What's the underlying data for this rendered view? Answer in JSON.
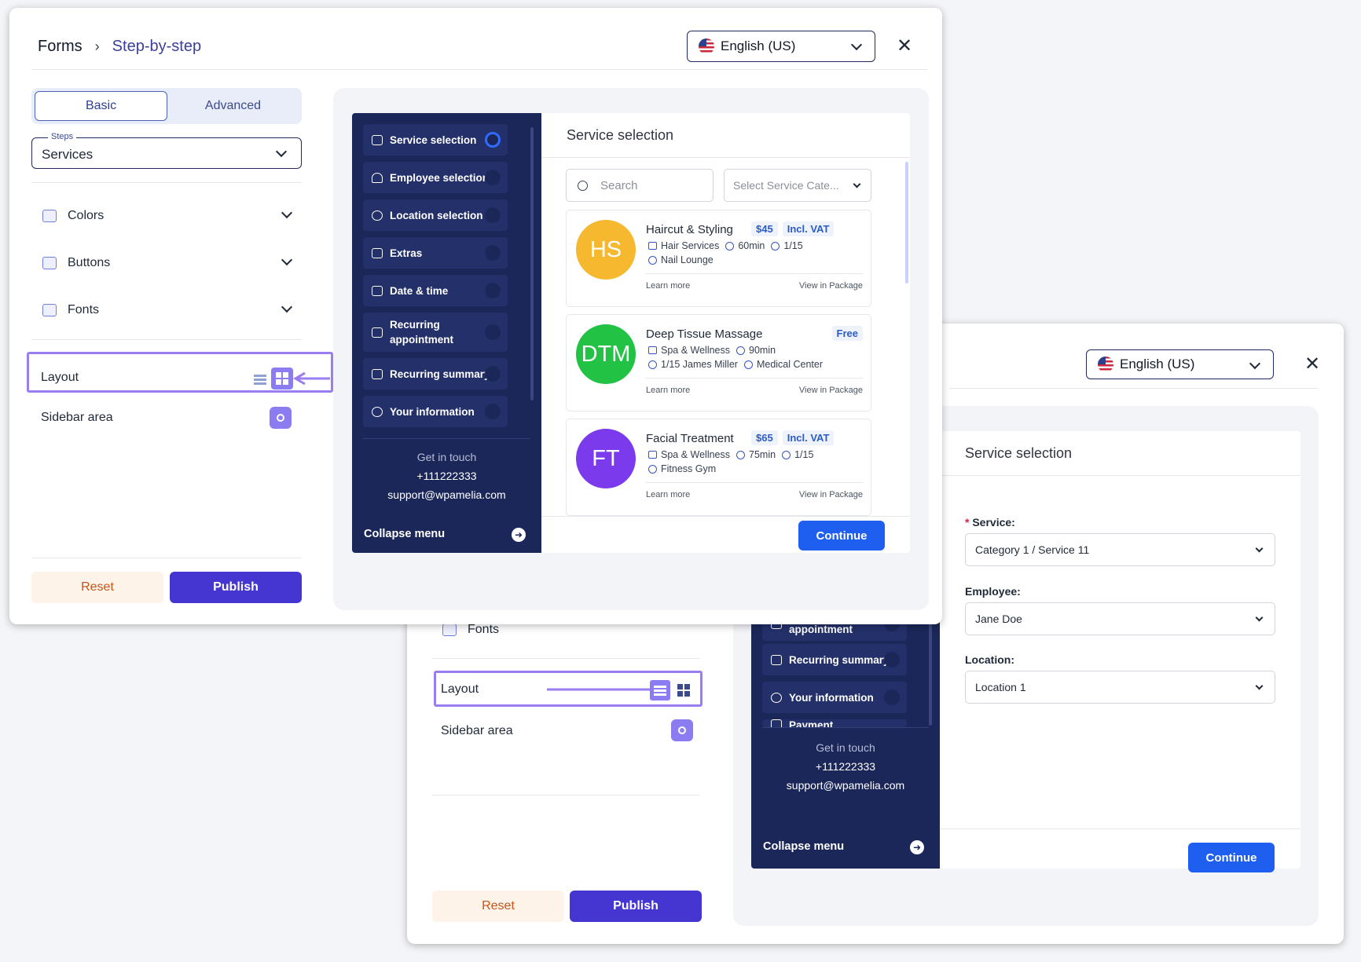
{
  "front": {
    "breadcrumb": {
      "root": "Forms",
      "current": "Step-by-step"
    },
    "language": "English (US)",
    "tabs": [
      "Basic",
      "Advanced"
    ],
    "steps_label": "Steps",
    "steps_value": "Services",
    "accordion": [
      "Colors",
      "Buttons",
      "Fonts"
    ],
    "layout_label": "Layout",
    "sidebar_area_label": "Sidebar area",
    "reset": "Reset",
    "publish": "Publish",
    "menu_steps": [
      "Service selection",
      "Employee selection",
      "Location selection",
      "Extras",
      "Date & time",
      "Recurring appointment",
      "Recurring summary",
      "Your information"
    ],
    "contact": {
      "heading": "Get in touch",
      "phone": "+111222333",
      "email": "support@wpamelia.com"
    },
    "collapse": "Collapse menu",
    "panel_title": "Service selection",
    "search_placeholder": "Search",
    "category_placeholder": "Select Service Cate...",
    "services": [
      {
        "initials": "HS",
        "name": "Haircut & Styling",
        "price": "$45",
        "vat": "Incl. VAT",
        "category": "Hair Services",
        "duration": "60min",
        "capacity": "1/15",
        "location": "Nail Lounge",
        "employee": "",
        "learn": "Learn more",
        "package": "View in Package",
        "color": "#f5b82e"
      },
      {
        "initials": "DTM",
        "name": "Deep Tissue Massage",
        "price": "Free",
        "vat": "",
        "category": "Spa & Wellness",
        "duration": "90min",
        "capacity": "1/15 James Miller",
        "location": "Medical Center",
        "employee": "",
        "learn": "Learn more",
        "package": "View in Package",
        "color": "#22c244"
      },
      {
        "initials": "FT",
        "name": "Facial Treatment",
        "price": "$65",
        "vat": "Incl. VAT",
        "category": "Spa & Wellness",
        "duration": "75min",
        "capacity": "1/15",
        "location": "Fitness Gym",
        "employee": "",
        "learn": "Learn more",
        "package": "View in Package",
        "color": "#7c3aed"
      }
    ],
    "continue": "Continue"
  },
  "back": {
    "language": "English (US)",
    "accordion_partial": "Fonts",
    "layout_label": "Layout",
    "sidebar_area_label": "Sidebar area",
    "reset": "Reset",
    "publish": "Publish",
    "menu_steps": [
      "Recurring appointment",
      "Recurring summary",
      "Your information",
      "Payment"
    ],
    "contact": {
      "heading": "Get in touch",
      "phone": "+111222333",
      "email": "support@wpamelia.com"
    },
    "collapse": "Collapse menu",
    "panel_title": "Service selection",
    "service_label": "Service:",
    "service_value": "Category 1 / Service 11",
    "employee_label": "Employee:",
    "employee_value": "Jane Doe",
    "location_label": "Location:",
    "location_value": "Location 1",
    "continue": "Continue"
  },
  "colors": {
    "accent": "#4535d1",
    "sidebar": "#1b2759",
    "highlight": "#9b7df2",
    "continue": "#1f5ff0"
  }
}
